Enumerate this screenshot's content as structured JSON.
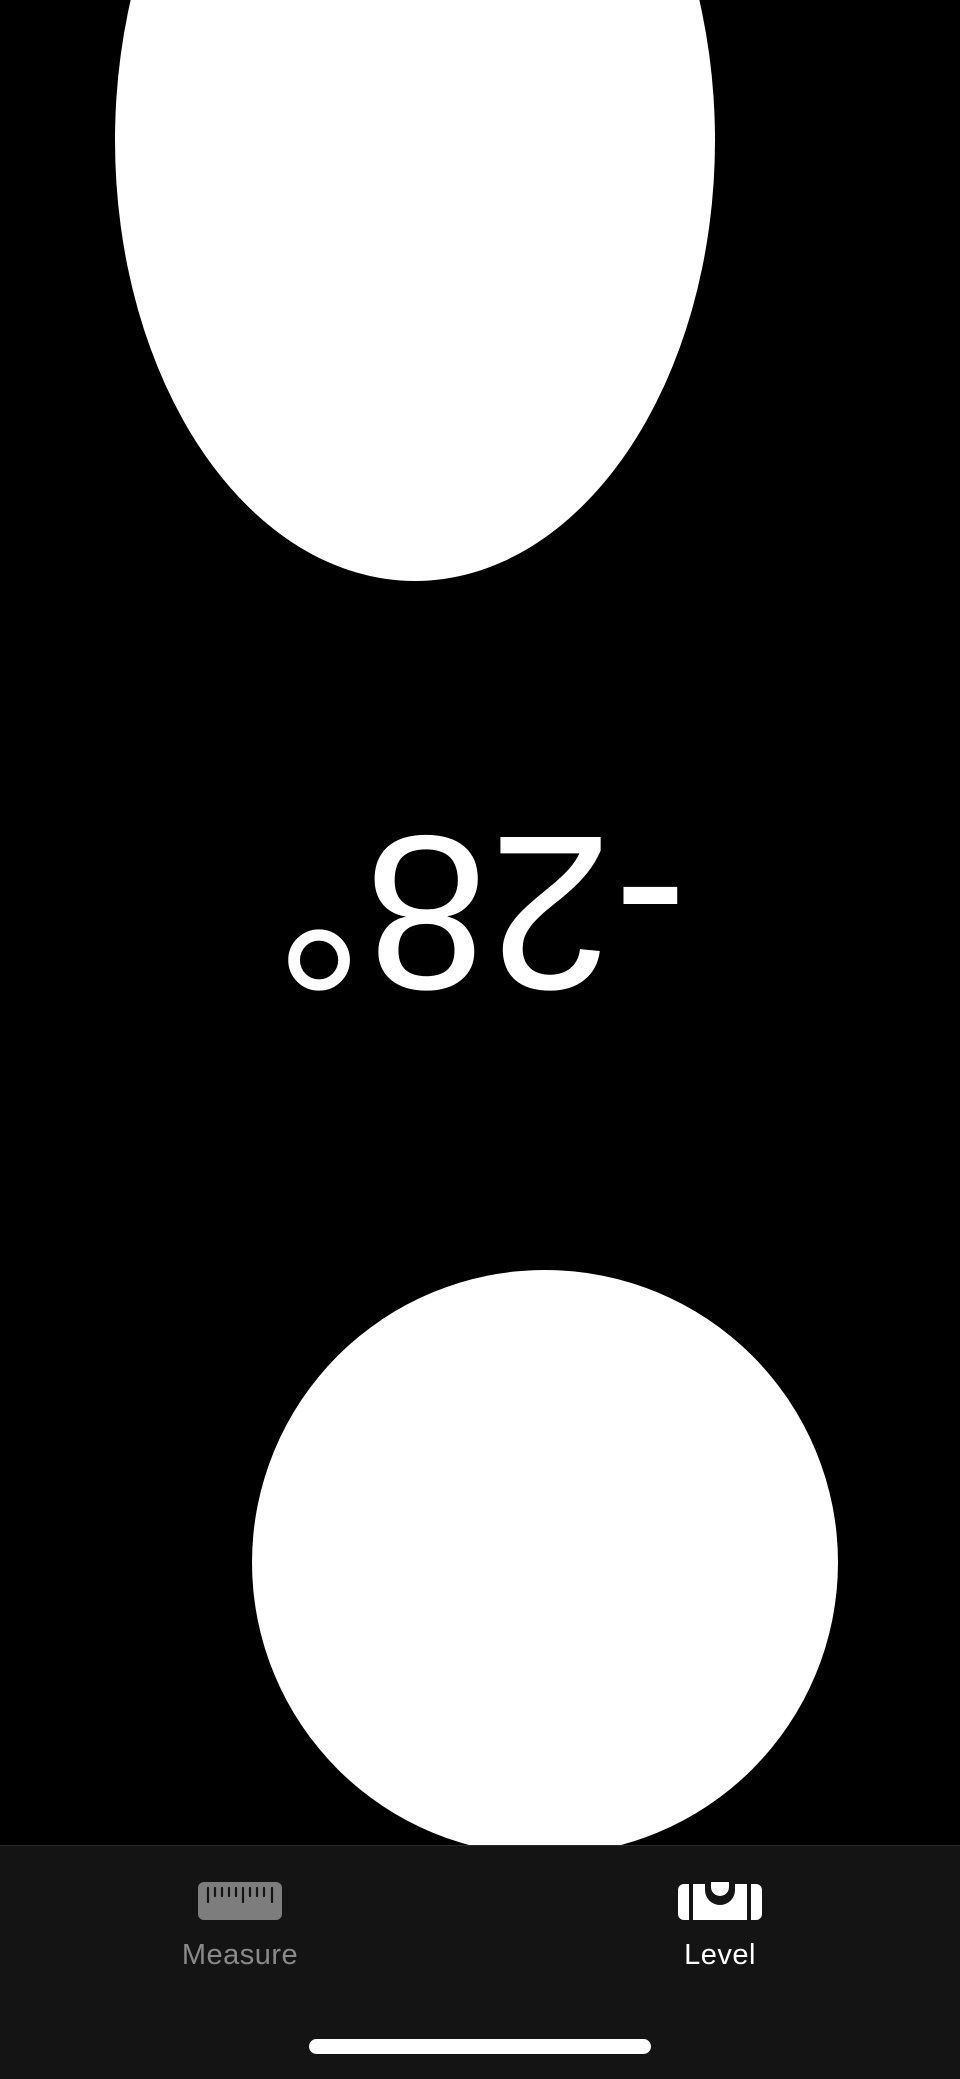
{
  "level": {
    "angle": "-28°"
  },
  "tab_bar": {
    "tabs": [
      {
        "label": "Measure",
        "icon": "ruler-icon",
        "selected": false
      },
      {
        "label": "Level",
        "icon": "level-icon",
        "selected": true
      }
    ]
  },
  "colors": {
    "background": "#000000",
    "bubble": "#ffffff",
    "tab_bar_background": "#141414",
    "tab_inactive": "#8a8a8a",
    "tab_active": "#ffffff"
  }
}
